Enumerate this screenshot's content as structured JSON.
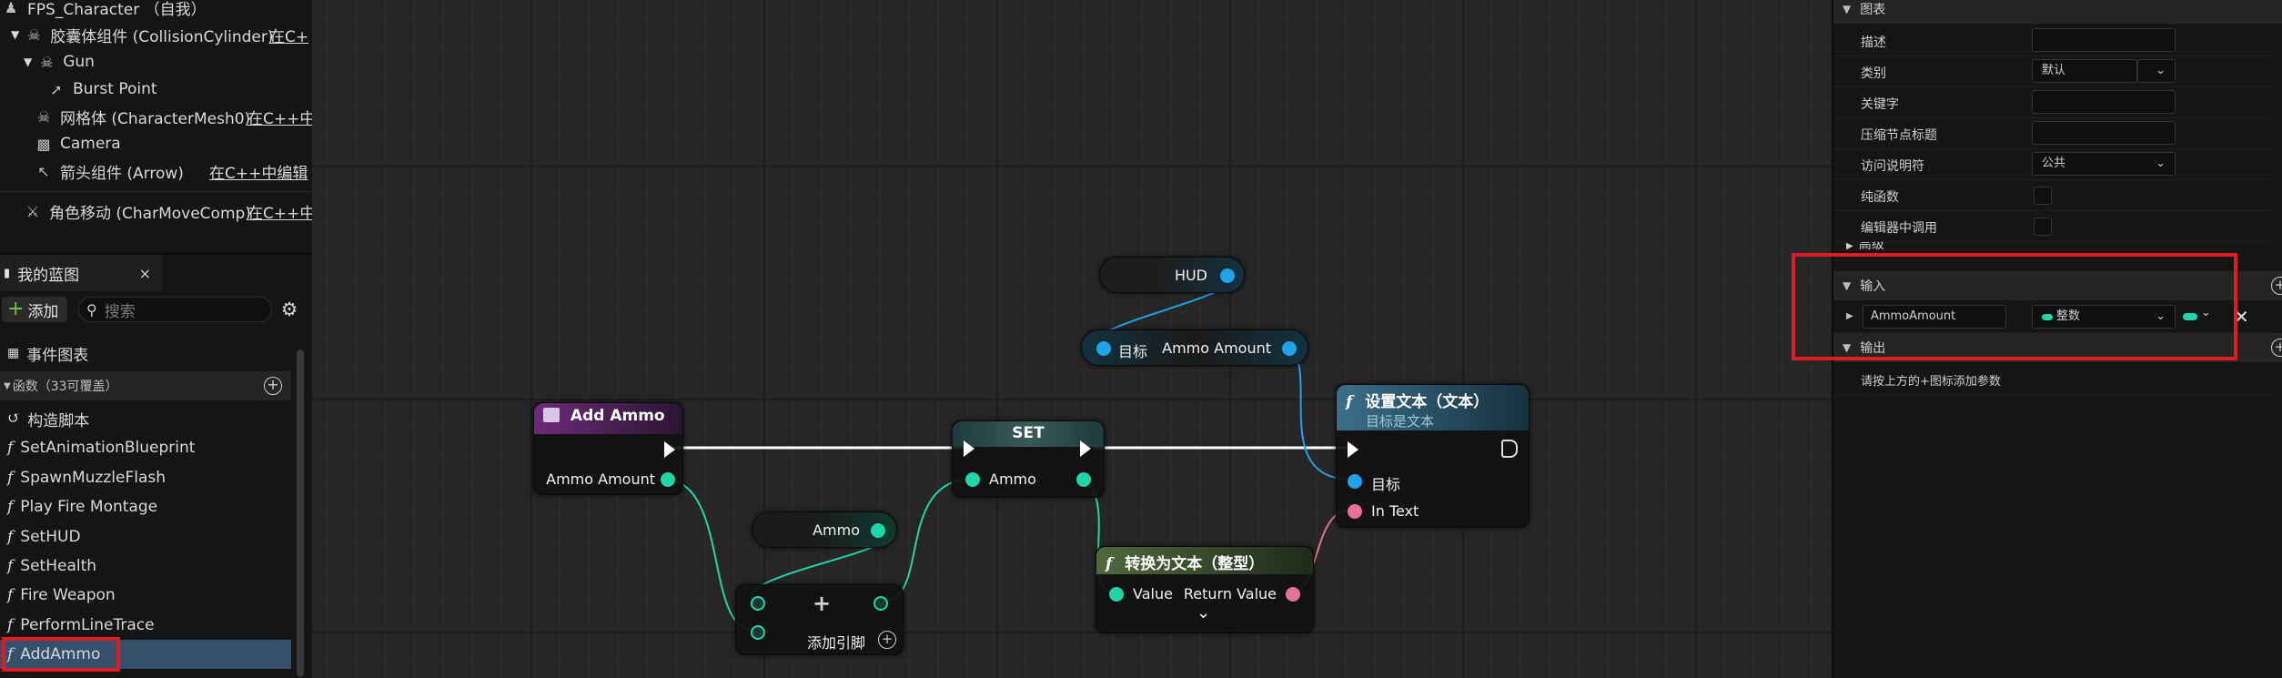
{
  "components": {
    "root": "FPS_Character （自我）",
    "items": [
      {
        "label": "胶囊体组件 (CollisionCylinder)",
        "edit": "在C+"
      },
      {
        "label": "Gun",
        "edit": ""
      },
      {
        "label": "Burst Point",
        "edit": ""
      },
      {
        "label": "网格体 (CharacterMesh0)",
        "edit": "在C++中"
      },
      {
        "label": "Camera",
        "edit": ""
      },
      {
        "label": "箭头组件 (Arrow)",
        "edit": "在C++中编辑"
      },
      {
        "label": "角色移动 (CharMoveComp)",
        "edit": "在C++中"
      }
    ]
  },
  "my_blueprint": {
    "tab_label": "我的蓝图",
    "close": "×",
    "add_label": "添加",
    "search_placeholder": "搜索",
    "event_graph": "事件图表",
    "functions_category": "函数（33可覆盖）",
    "functions": [
      "构造脚本",
      "SetAnimationBlueprint",
      "SpawnMuzzleFlash",
      "Play Fire Montage",
      "SetHUD",
      "SetHealth",
      "Fire Weapon",
      "PerformLineTrace",
      "AddAmmo"
    ],
    "selected": "AddAmmo"
  },
  "graph": {
    "nodes": {
      "hud_var": {
        "label": "HUD"
      },
      "ammo_get": {
        "target": "目标",
        "output": "Ammo Amount"
      },
      "add_ammo": {
        "title": "Add Ammo",
        "param": "Ammo Amount"
      },
      "set_node": {
        "title": "SET",
        "pin": "Ammo"
      },
      "ammo_var": {
        "label": "Ammo"
      },
      "add_node": {
        "plus": "+",
        "label": "添加引脚"
      },
      "to_text": {
        "title": "转换为文本（整型）",
        "in": "Value",
        "out": "Return Value",
        "expand": "⌄"
      },
      "set_text": {
        "title": "设置文本（文本）",
        "subtitle": "目标是文本",
        "target": "目标",
        "in_text": "In Text"
      }
    },
    "colors": {
      "exec": "#ffffff",
      "int": "#1fd6a8",
      "object": "#1fa3e8",
      "text": "#e5709a",
      "func_head": "#3a6f8a",
      "event_head": "#7a2e7c",
      "pure_head": "#4e6a3c"
    }
  },
  "details": {
    "graph_category": "图表",
    "rows": [
      {
        "label": "描述",
        "value": ""
      },
      {
        "label": "类别",
        "value": "默认"
      },
      {
        "label": "关键字",
        "value": ""
      },
      {
        "label": "压缩节点标题",
        "value": ""
      },
      {
        "label": "访问说明符",
        "value": "公共"
      },
      {
        "label": "纯函数",
        "value": ""
      },
      {
        "label": "编辑器中调用",
        "value": ""
      }
    ],
    "advanced": "高级",
    "inputs_category": "输入",
    "input_param": {
      "name": "AmmoAmount",
      "type": "整数"
    },
    "outputs_category": "输出",
    "outputs_hint": "请按上方的+图标添加参数"
  }
}
